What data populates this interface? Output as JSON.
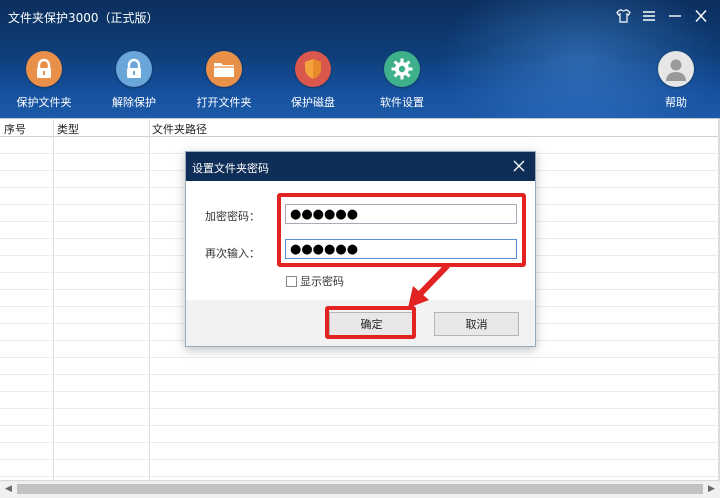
{
  "window": {
    "title": "文件夹保护3000（正式版）",
    "controls": [
      "shirt-icon",
      "menu-icon",
      "minimize-icon",
      "close-icon"
    ]
  },
  "toolbar": {
    "items": [
      {
        "label": "保护文件夹",
        "icon": "lock-icon",
        "color": "#e8904a"
      },
      {
        "label": "解除保护",
        "icon": "unlock-icon",
        "color": "#6aa6da"
      },
      {
        "label": "打开文件夹",
        "icon": "folder-icon",
        "color": "#e8904a"
      },
      {
        "label": "保护磁盘",
        "icon": "shield-icon",
        "color": "#d9574c"
      },
      {
        "label": "软件设置",
        "icon": "gear-icon",
        "color": "#3fb08c"
      }
    ],
    "help": {
      "label": "帮助",
      "icon": "user-icon",
      "color": "#cccccc"
    }
  },
  "table": {
    "columns": [
      "序号",
      "类型",
      "文件夹路径"
    ],
    "rows": []
  },
  "dialog": {
    "title": "设置文件夹密码",
    "password_label": "加密密码：",
    "password_value": "●●●●●●",
    "confirm_label": "再次输入：",
    "confirm_value": "●●●●●●",
    "show_password_label": "显示密码",
    "show_password_checked": false,
    "ok_label": "确定",
    "cancel_label": "取消"
  },
  "annotations": {
    "highlight_color": "#e32222"
  }
}
